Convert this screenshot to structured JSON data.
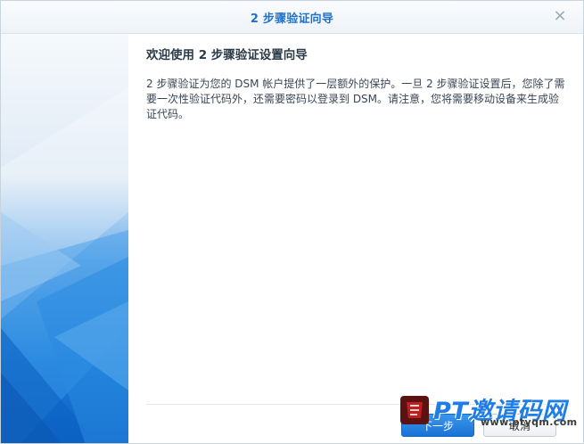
{
  "window": {
    "title": "2 步骤验证向导",
    "close_symbol": "×"
  },
  "content": {
    "heading": "欢迎使用 2 步骤验证设置向导",
    "description": "2 步骤验证为您的 DSM 帐户提供了一层额外的保护。一旦 2 步骤验证设置后，您除了需要一次性验证代码外，还需要密码以登录到 DSM。请注意，您将需要移动设备来生成验证代码。"
  },
  "buttons": {
    "next": "下一步",
    "cancel": "取消"
  },
  "watermark": {
    "text": "PT邀请码网",
    "url": "www.ptyqm.com"
  },
  "colors": {
    "accent": "#1f72c8",
    "sidebar_top": "#f4f8fc",
    "sidebar_bottom": "#0a63c9"
  },
  "icons": [
    "close-icon",
    "watermark-logo-icon"
  ]
}
